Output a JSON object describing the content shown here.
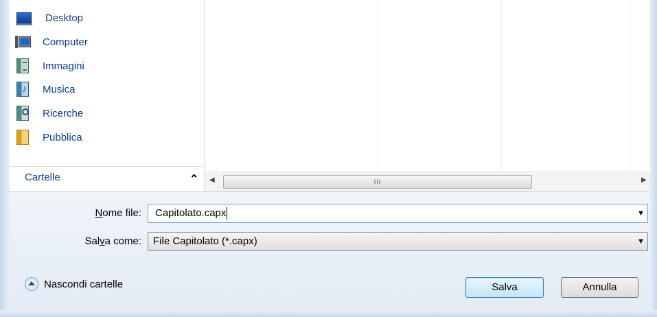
{
  "nav": {
    "items": [
      {
        "label": "Desktop",
        "icon": "desktop-icon"
      },
      {
        "label": "Computer",
        "icon": "computer-icon"
      },
      {
        "label": "Immagini",
        "icon": "pictures-library-icon"
      },
      {
        "label": "Musica",
        "icon": "music-library-icon"
      },
      {
        "label": "Ricerche",
        "icon": "searches-icon"
      },
      {
        "label": "Pubblica",
        "icon": "folder-icon"
      }
    ],
    "folders_header": "Cartelle"
  },
  "scrollbar": {
    "grip": "III"
  },
  "form": {
    "filename_label_u": "N",
    "filename_label_rest": "ome file:",
    "filename_value": "Capitolato.capx",
    "savetype_label_a": "Sal",
    "savetype_label_u": "v",
    "savetype_label_b": "a come:",
    "savetype_value": "File Capitolato (*.capx)"
  },
  "footer": {
    "hide_folders": "Nascondi cartelle",
    "save_label": "Salva",
    "cancel_label": "Annulla"
  },
  "colors": {
    "link": "#0f3d8a",
    "accent": "#3c7fb1"
  }
}
